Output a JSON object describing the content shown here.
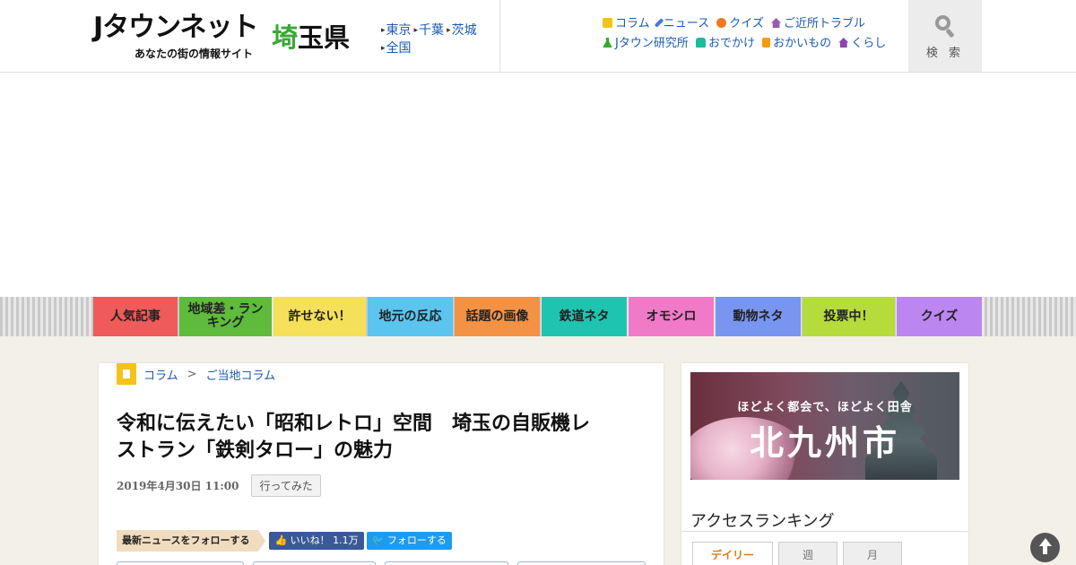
{
  "header": {
    "logo_main": "Jタウンネット",
    "logo_sub": "あなたの街の情報サイト",
    "pref_first": "埼",
    "pref_rest": "玉県",
    "pref_links": [
      "東京",
      "千葉",
      "茨城",
      "全国"
    ],
    "categories": [
      {
        "label": "コラム",
        "icon": "note-icon",
        "color": "#f4c21b"
      },
      {
        "label": "ニュース",
        "icon": "pencil-icon",
        "color": "#3b7dd8"
      },
      {
        "label": "クイズ",
        "icon": "quiz-icon",
        "color": "#f0781e"
      },
      {
        "label": "ご近所トラブル",
        "icon": "house-icon",
        "color": "#9b59b6"
      },
      {
        "label": "Jタウン研究所",
        "icon": "flask-icon",
        "color": "#39a935"
      },
      {
        "label": "おでかけ",
        "icon": "car-icon",
        "color": "#1abc9c"
      },
      {
        "label": "おかいもの",
        "icon": "bag-icon",
        "color": "#f39c12"
      },
      {
        "label": "くらし",
        "icon": "home-icon",
        "color": "#8e44ad"
      }
    ],
    "search_label": "検 索"
  },
  "category_bar": [
    {
      "label": "人気記事",
      "color": "#ef5a5a"
    },
    {
      "label": "地域差・ランキング",
      "color": "#5fbb3c"
    },
    {
      "label": "許せない！",
      "color": "#f5e05a"
    },
    {
      "label": "地元の反応",
      "color": "#5bc4ef"
    },
    {
      "label": "話題の画像",
      "color": "#f39245"
    },
    {
      "label": "鉄道ネタ",
      "color": "#1fc4b0"
    },
    {
      "label": "オモシロ",
      "color": "#f17ac8"
    },
    {
      "label": "動物ネタ",
      "color": "#7895f0"
    },
    {
      "label": "投票中！",
      "color": "#b6dc3c"
    },
    {
      "label": "クイズ",
      "color": "#bb86f0"
    }
  ],
  "article": {
    "breadcrumb": [
      "コラム",
      "ご当地コラム"
    ],
    "breadcrumb_sep": ">",
    "title_line1": "令和に伝えたい「昭和レトロ」空間　埼玉の自販機レ",
    "title_line2": "ストラン「鉄剣タロー」の魅力",
    "date": "2019年4月30日 11:00",
    "tag": "行ってみた",
    "follow_label": "最新ニュースをフォローする",
    "fb_label": "いいね！ 1.1万",
    "tw_label": "フォローする"
  },
  "sidebar": {
    "banner_tagline": "ほどよく都会で、ほどよく田舎",
    "banner_city": "北九州市",
    "ranking_title": "アクセスランキング",
    "ranking_tabs": [
      "デイリー",
      "週",
      "月"
    ]
  }
}
